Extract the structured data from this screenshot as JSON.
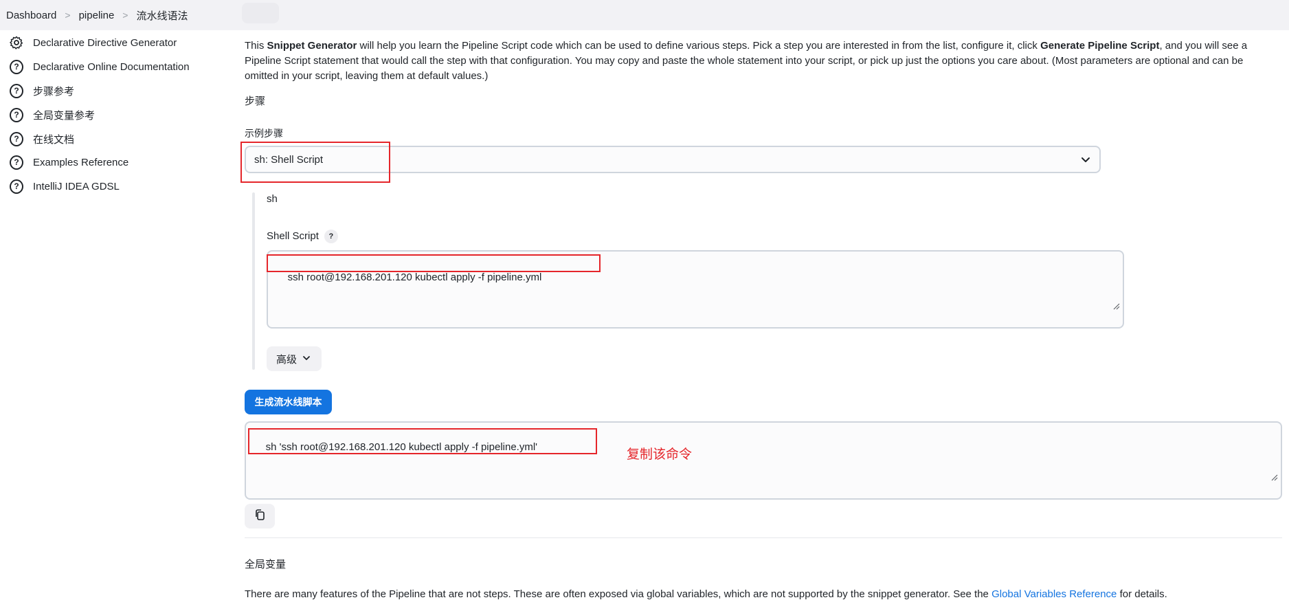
{
  "breadcrumb": {
    "items": [
      "Dashboard",
      "pipeline",
      "流水线语法"
    ],
    "separator": ">"
  },
  "sidebar": {
    "items": [
      {
        "label": "Declarative Directive Generator",
        "icon": "gear-icon"
      },
      {
        "label": "Declarative Online Documentation",
        "icon": "help-circle-icon"
      },
      {
        "label": "步骤参考",
        "icon": "help-circle-icon"
      },
      {
        "label": "全局变量参考",
        "icon": "help-circle-icon"
      },
      {
        "label": "在线文档",
        "icon": "help-circle-icon"
      },
      {
        "label": "Examples Reference",
        "icon": "help-circle-icon"
      },
      {
        "label": "IntelliJ IDEA GDSL",
        "icon": "help-circle-icon"
      }
    ]
  },
  "intro": {
    "part1": "This ",
    "bold1": "Snippet Generator",
    "part2": " will help you learn the Pipeline Script code which can be used to define various steps. Pick a step you are interested in from the list, configure it, click ",
    "bold2": "Generate Pipeline Script",
    "part3": ", and you will see a Pipeline Script statement that would call the step with that configuration. You may copy and paste the whole statement into your script, or pick up just the options you care about. (Most parameters are optional and can be omitted in your script, leaving them at default values.)"
  },
  "steps": {
    "section_label": "步骤",
    "select_label": "示例步骤",
    "select_value": "sh: Shell Script"
  },
  "step_config": {
    "step_name": "sh",
    "field_label": "Shell Script",
    "help_label": "?",
    "script_value": "ssh root@192.168.201.120 kubectl apply -f pipeline.yml",
    "advanced_label": "高级"
  },
  "generate": {
    "button_label": "生成流水线脚本",
    "output_value": "sh 'ssh root@192.168.201.120 kubectl apply -f pipeline.yml'",
    "annotation": "复制该命令"
  },
  "global_vars": {
    "section_label": "全局变量",
    "cut_text_start": "There are many features of the Pipeline that are not steps. These are often exposed via global variables, which are not supported by the snippet generator. See the ",
    "cut_link": "Global Variables Reference",
    "cut_text_end": " for details."
  },
  "colors": {
    "accent": "#1474e0",
    "annotation_red": "#e5252a",
    "breadcrumb_bg": "#f2f2f5"
  }
}
